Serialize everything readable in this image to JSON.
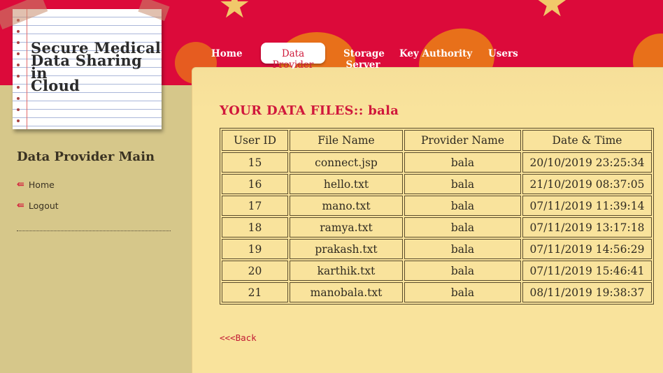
{
  "logo": {
    "title_line1": "Secure Medical",
    "title_line2": "Data Sharing in",
    "title_line3": "Cloud"
  },
  "nav": {
    "items": [
      {
        "label": "Home"
      },
      {
        "label": "Data Provider"
      },
      {
        "label": "Storage"
      },
      {
        "label": "Server"
      },
      {
        "label": "Key Authority"
      },
      {
        "label": "Users"
      }
    ],
    "active": "Data Provider"
  },
  "sidebar": {
    "title": "Data Provider Main",
    "links": [
      {
        "label": "Home"
      },
      {
        "label": "Logout"
      }
    ]
  },
  "main": {
    "heading": "YOUR DATA FILES:: bala",
    "columns": [
      "User ID",
      "File Name",
      "Provider Name",
      "Date & Time"
    ],
    "rows": [
      [
        "15",
        "connect.jsp",
        "bala",
        "20/10/2019 23:25:34"
      ],
      [
        "16",
        "hello.txt",
        "bala",
        "21/10/2019 08:37:05"
      ],
      [
        "17",
        "mano.txt",
        "bala",
        "07/11/2019 11:39:14"
      ],
      [
        "18",
        "ramya.txt",
        "bala",
        "07/11/2019 13:17:18"
      ],
      [
        "19",
        "prakash.txt",
        "bala",
        "07/11/2019 14:56:29"
      ],
      [
        "20",
        "karthik.txt",
        "bala",
        "07/11/2019 15:46:41"
      ],
      [
        "21",
        "manobala.txt",
        "bala",
        "08/11/2019 19:38:37"
      ]
    ],
    "back_link": "<<<Back"
  },
  "colors": {
    "header_red": "#dc0a3a",
    "accent": "#d0183c",
    "panel": "#f9e39c",
    "sidebar": "#d6c78a"
  }
}
